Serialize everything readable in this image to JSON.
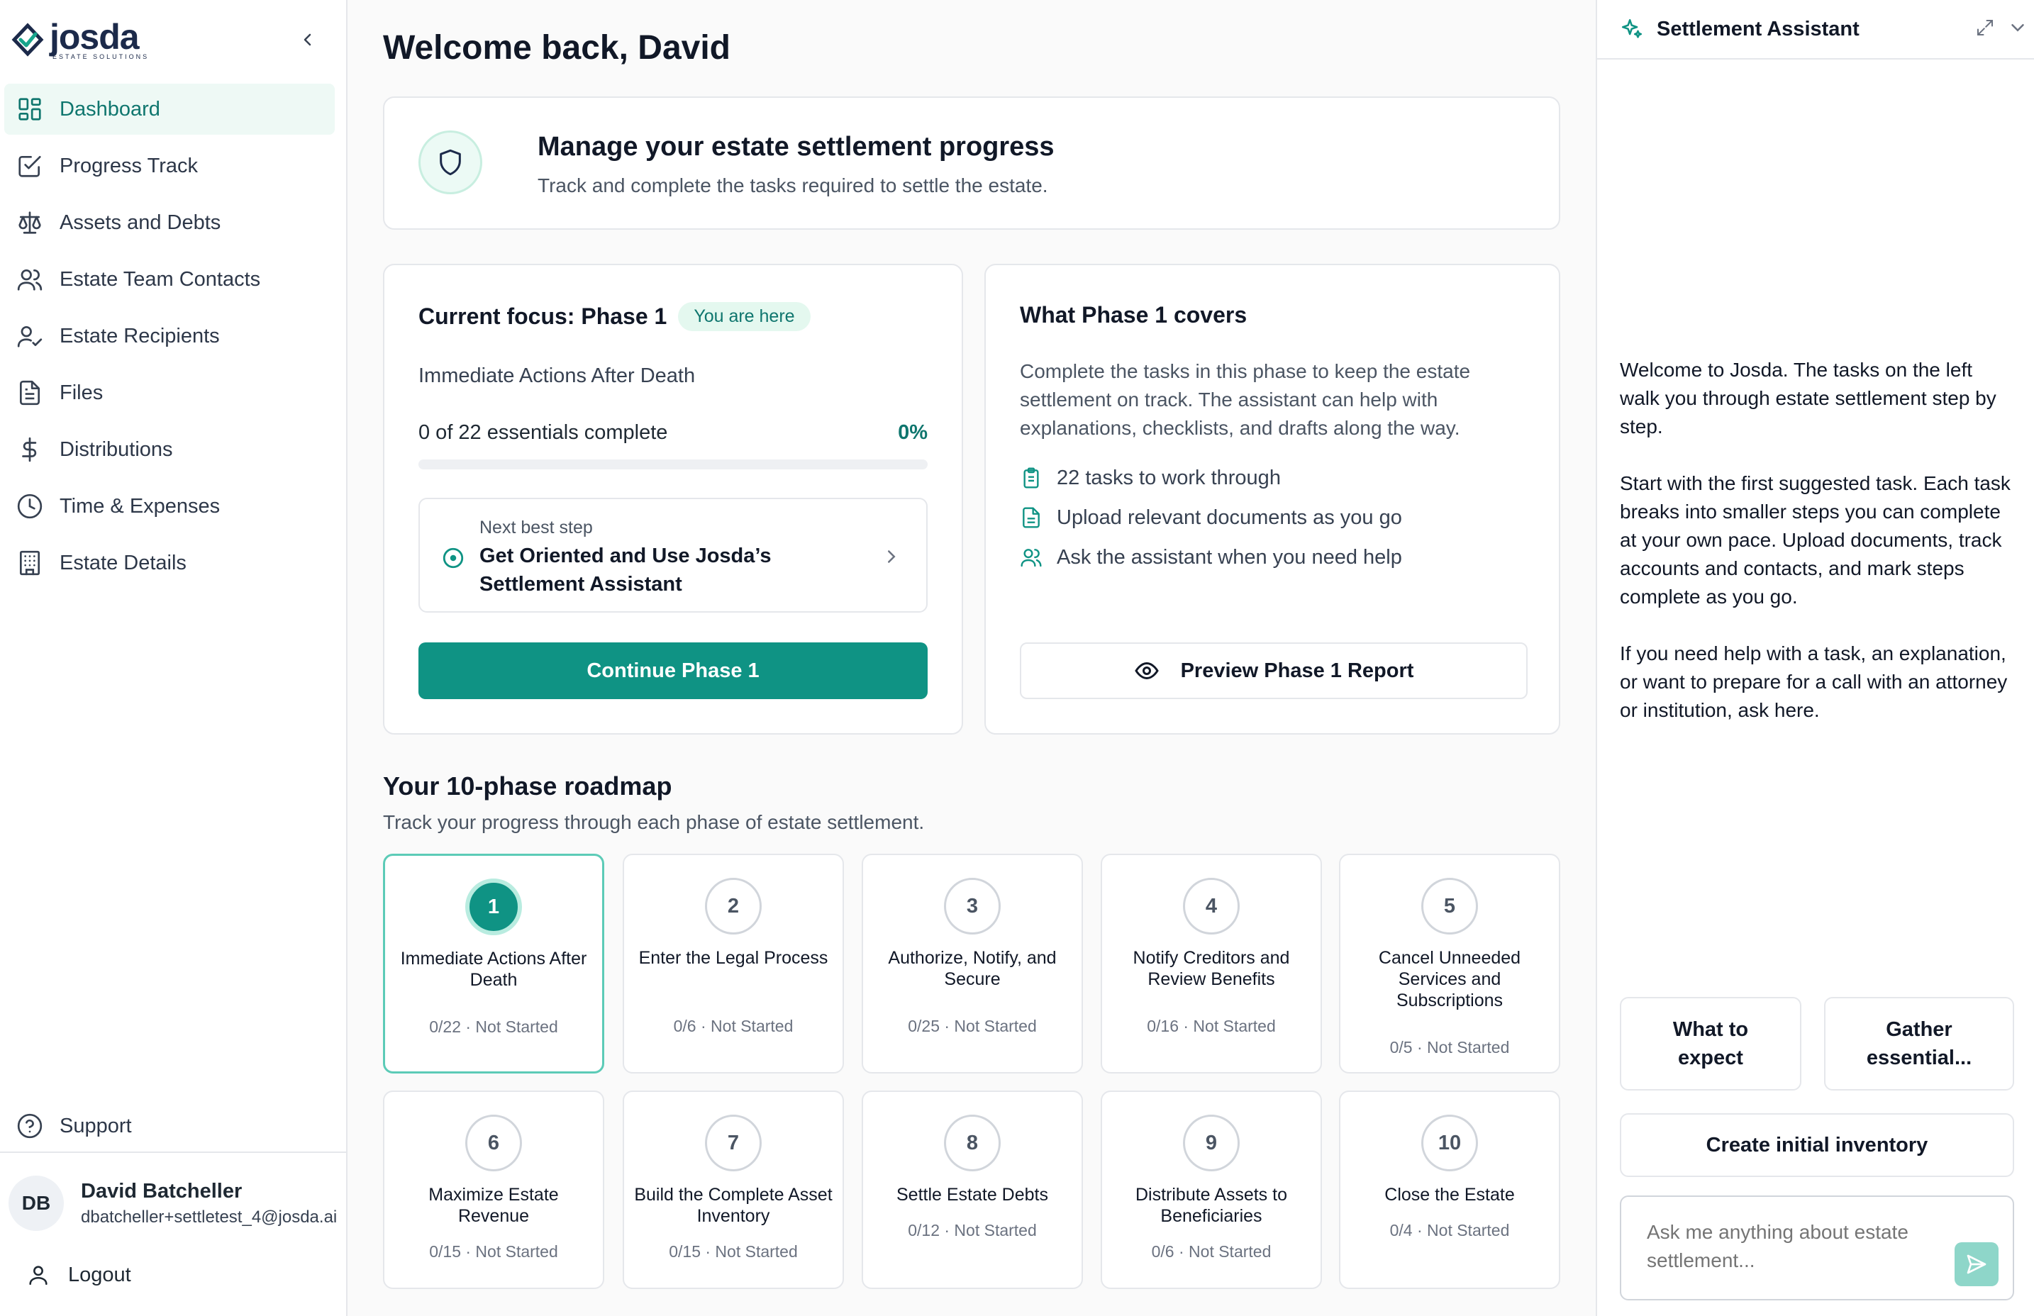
{
  "brand": {
    "logo_word": "josda",
    "logo_sub": "ESTATE SOLUTIONS"
  },
  "sidebar": {
    "items": [
      {
        "label": "Dashboard",
        "icon": "dashboard-grid-icon",
        "active": true
      },
      {
        "label": "Progress Track",
        "icon": "checkbox-pencil-icon",
        "active": false
      },
      {
        "label": "Assets and Debts",
        "icon": "scale-icon",
        "active": false
      },
      {
        "label": "Estate Team Contacts",
        "icon": "users-icon",
        "active": false
      },
      {
        "label": "Estate Recipients",
        "icon": "user-check-icon",
        "active": false
      },
      {
        "label": "Files",
        "icon": "file-icon",
        "active": false
      },
      {
        "label": "Distributions",
        "icon": "dollar-icon",
        "active": false
      },
      {
        "label": "Time & Expenses",
        "icon": "clock-icon",
        "active": false
      },
      {
        "label": "Estate Details",
        "icon": "building-icon",
        "active": false
      }
    ],
    "support_label": "Support",
    "user": {
      "initials": "DB",
      "name": "David Batcheller",
      "email": "dbatcheller+settletest_4@josda.ai"
    },
    "logout_label": "Logout"
  },
  "main": {
    "title": "Welcome back, David",
    "banner": {
      "title": "Manage your estate settlement progress",
      "subtitle": "Track and complete the tasks required to settle the estate."
    },
    "focus": {
      "title": "Current focus: Phase 1",
      "badge": "You are here",
      "phase_name": "Immediate Actions After Death",
      "count_text": "0 of 22 essentials complete",
      "percent_text": "0%",
      "progress_fraction": 0,
      "next_step_label": "Next best step",
      "next_step_title": "Get Oriented and Use Josda’s Settlement Assistant",
      "continue_label": "Continue Phase 1"
    },
    "covers": {
      "title": "What Phase 1 covers",
      "body": "Complete the tasks in this phase to keep the estate settlement on track. The assistant can help with explanations, checklists, and drafts along the way.",
      "items": [
        {
          "text": "22 tasks to work through",
          "icon": "clipboard-icon"
        },
        {
          "text": "Upload relevant documents as you go",
          "icon": "document-icon"
        },
        {
          "text": "Ask the assistant when you need help",
          "icon": "users-icon"
        }
      ],
      "preview_label": "Preview Phase 1 Report"
    },
    "roadmap": {
      "title": "Your 10-phase roadmap",
      "subtitle": "Track your progress through each phase of estate settlement.",
      "phases": [
        {
          "num": "1",
          "name": "Immediate Actions After Death",
          "status": "0/22 · Not Started",
          "active": true
        },
        {
          "num": "2",
          "name": "Enter the Legal Process",
          "status": "0/6 · Not Started",
          "active": false
        },
        {
          "num": "3",
          "name": "Authorize, Notify, and Secure",
          "status": "0/25 · Not Started",
          "active": false
        },
        {
          "num": "4",
          "name": "Notify Creditors and Review Benefits",
          "status": "0/16 · Not Started",
          "active": false
        },
        {
          "num": "5",
          "name": "Cancel Unneeded Services and Subscriptions",
          "status": "0/5 · Not Started",
          "active": false
        },
        {
          "num": "6",
          "name": "Maximize Estate Revenue",
          "status": "0/15 · Not Started",
          "active": false
        },
        {
          "num": "7",
          "name": "Build the Complete Asset Inventory",
          "status": "0/15 · Not Started",
          "active": false
        },
        {
          "num": "8",
          "name": "Settle Estate Debts",
          "status": "0/12 · Not Started",
          "active": false
        },
        {
          "num": "9",
          "name": "Distribute Assets to Beneficiaries",
          "status": "0/6 · Not Started",
          "active": false
        },
        {
          "num": "10",
          "name": "Close the Estate",
          "status": "0/4 · Not Started",
          "active": false
        }
      ]
    }
  },
  "assistant": {
    "title": "Settlement Assistant",
    "messages": [
      "Welcome to Josda. The tasks on the left walk you through estate settlement step by step.",
      "Start with the first suggested task. Each task breaks into smaller steps you can complete at your own pace. Upload documents, track accounts and contacts, and mark steps complete as you go.",
      "If you need help with a task, an explanation, or want to prepare for a call with an attorney or institution, ask here."
    ],
    "chips": [
      "What to expect",
      "Gather essential...",
      "Create initial inventory"
    ],
    "input_placeholder": "Ask me anything about estate settlement..."
  },
  "colors": {
    "accent": "#0f9384",
    "accent_light": "#eef9f5",
    "accent_text": "#0f766e"
  }
}
